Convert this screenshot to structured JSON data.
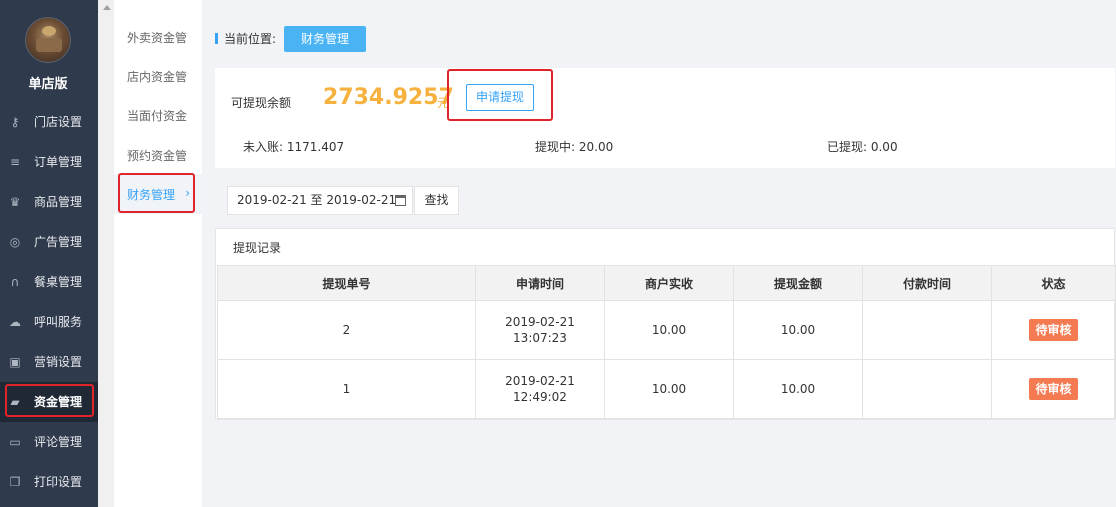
{
  "sidebar": {
    "store_name": "单店版",
    "items": [
      {
        "label": "门店设置",
        "icon": "key-icon"
      },
      {
        "label": "订单管理",
        "icon": "list-icon"
      },
      {
        "label": "商品管理",
        "icon": "trophy-icon"
      },
      {
        "label": "广告管理",
        "icon": "lifebuoy-icon"
      },
      {
        "label": "餐桌管理",
        "icon": "binoculars-icon"
      },
      {
        "label": "呼叫服务",
        "icon": "cloud-icon"
      },
      {
        "label": "营销设置",
        "icon": "gift-icon"
      },
      {
        "label": "资金管理",
        "icon": "book-icon"
      },
      {
        "label": "评论管理",
        "icon": "money-icon"
      },
      {
        "label": "打印设置",
        "icon": "copy-icon"
      }
    ]
  },
  "submenu": {
    "items": [
      {
        "label": "外卖资金管"
      },
      {
        "label": "店内资金管"
      },
      {
        "label": "当面付资金"
      },
      {
        "label": "预约资金管"
      },
      {
        "label": "财务管理"
      }
    ]
  },
  "breadcrumb": {
    "label": "当前位置:",
    "current": "财务管理"
  },
  "balance": {
    "label": "可提现余额",
    "amount": "2734.9257",
    "unit": "元",
    "apply_button": "申请提现",
    "pending_label": "未入账: 1171.407",
    "withdrawing_label": "提现中: 20.00",
    "withdrawn_label": "已提现: 0.00"
  },
  "filter": {
    "date_range": "2019-02-21 至 2019-02-21",
    "search_button": "查找"
  },
  "records": {
    "title": "提现记录",
    "columns": [
      "提现单号",
      "申请时间",
      "商户实收",
      "提现金额",
      "付款时间",
      "状态"
    ],
    "rows": [
      {
        "id": "2",
        "date": "2019-02-21",
        "time": "13:07:23",
        "received": "10.00",
        "amount": "10.00",
        "paid_time": "",
        "status": "待审核"
      },
      {
        "id": "1",
        "date": "2019-02-21",
        "time": "12:49:02",
        "received": "10.00",
        "amount": "10.00",
        "paid_time": "",
        "status": "待审核"
      }
    ]
  },
  "colors": {
    "accent": "#36a3f7",
    "amount": "#f6b13e",
    "status": "#f47a52",
    "sidebar": "#2f3a4c",
    "highlight": "#e0242a"
  }
}
